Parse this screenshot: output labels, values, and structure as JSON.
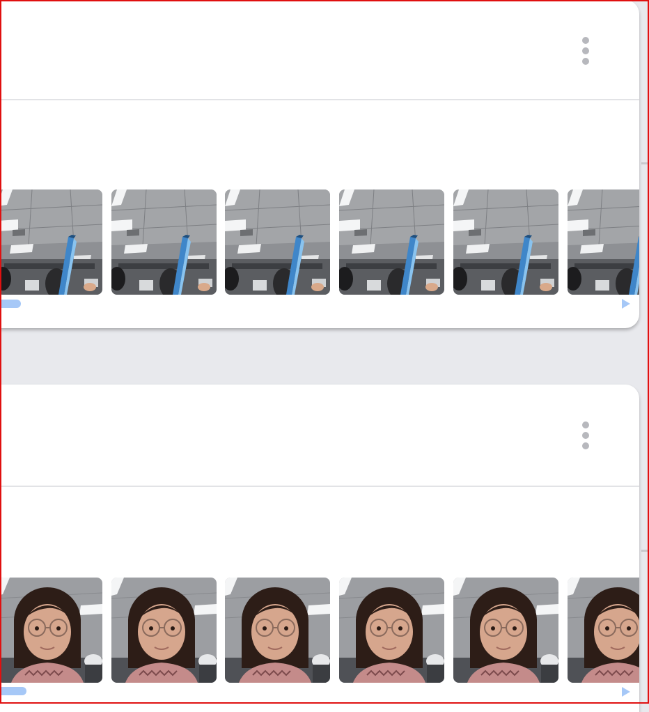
{
  "colors": {
    "page_background": "#e8e9ed",
    "card_background": "#ffffff",
    "kebab_dots": "#b7b8bd",
    "scrollbar_accent": "#a6c8f7",
    "frame_border": "#e01010"
  },
  "cards": [
    {
      "menu_icon": "more-vert-icon",
      "thumbnail_subject": "office-ceiling-with-blue-pen",
      "thumbnail_count": 6,
      "scroll_prev_icon": "scrollbar-thumb",
      "scroll_next_icon": "play-right-icon"
    },
    {
      "menu_icon": "more-vert-icon",
      "thumbnail_subject": "woman-with-glasses-selfie",
      "thumbnail_count": 6,
      "scroll_prev_icon": "scrollbar-thumb",
      "scroll_next_icon": "play-right-icon"
    }
  ]
}
